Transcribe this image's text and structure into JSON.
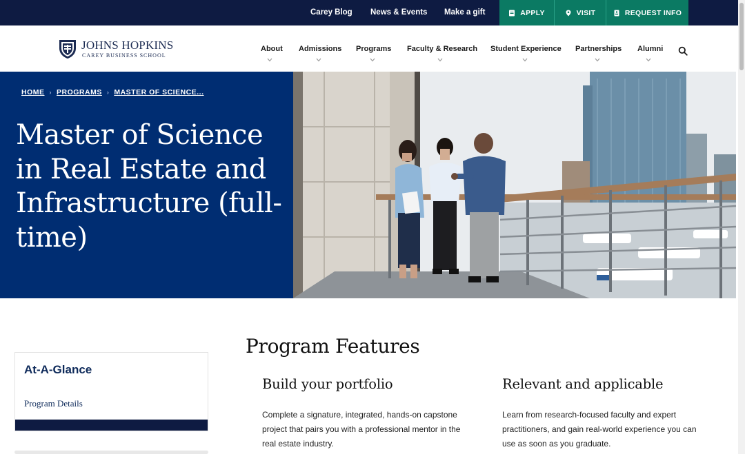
{
  "utility_bar": {
    "links": [
      "Carey Blog",
      "News & Events",
      "Make a gift"
    ],
    "ctas": [
      {
        "label": "APPLY",
        "icon": "document-icon"
      },
      {
        "label": "VISIT",
        "icon": "map-pin-icon"
      },
      {
        "label": "REQUEST INFO",
        "icon": "info-card-icon"
      }
    ],
    "colors": {
      "bar": "#0e1b42",
      "cta": "#0b7a63"
    }
  },
  "header": {
    "logo_name": "JOHNS HOPKINS",
    "logo_sub": "CAREY BUSINESS SCHOOL",
    "nav": [
      "About",
      "Admissions",
      "Programs",
      "Faculty & Research",
      "Student Experience",
      "Partnerships",
      "Alumni"
    ]
  },
  "hero": {
    "breadcrumb": [
      "HOME",
      "PROGRAMS",
      "MASTER OF SCIENCE..."
    ],
    "title": "Master of Science in Real Estate and Infrastructure (full-time)",
    "background_color": "#002d72"
  },
  "sidebar": {
    "title": "At-A-Glance",
    "link": "Program Details"
  },
  "features": {
    "title": "Program Features",
    "items": [
      {
        "heading": "Build your portfolio",
        "body": "Complete a signature, integrated, hands-on capstone project that pairs you with a professional mentor in the real estate industry."
      },
      {
        "heading": "Relevant and applicable",
        "body": "Learn from research-focused faculty and expert practitioners, and gain real-world experience you can use as soon as you graduate."
      }
    ]
  }
}
